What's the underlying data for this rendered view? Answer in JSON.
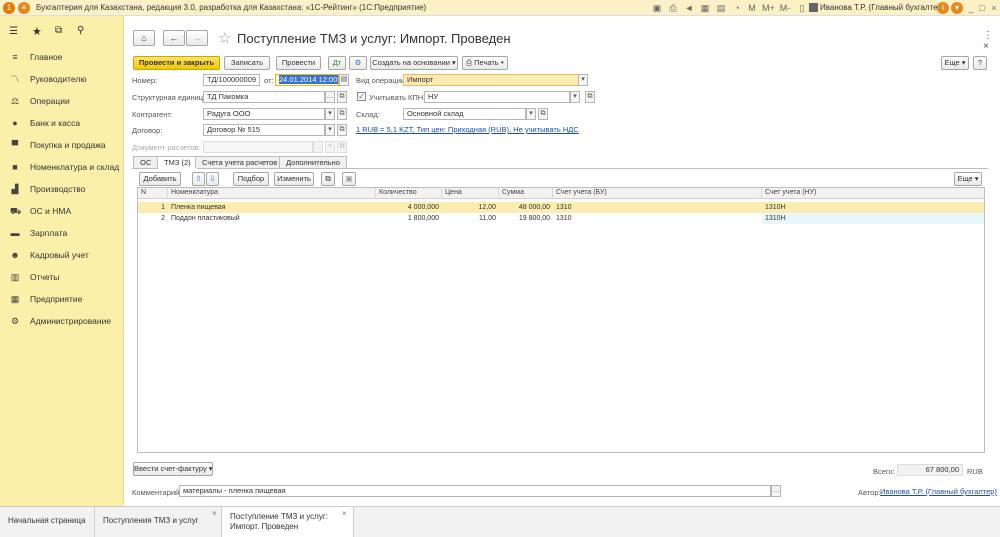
{
  "window": {
    "title": "Бухгалтерия для Казахстана, редакция 3.0, разработка для Казахстана: «1С-Рейтинг» (1С:Предприятие)",
    "user": "Иванова Т.Р. (Главный бухгалтер)",
    "buttons": [
      "M",
      "M+",
      "M-"
    ]
  },
  "sidebar": {
    "items": [
      {
        "label": "Главное",
        "icon": "menu-icon"
      },
      {
        "label": "Руководителю",
        "icon": "chart-line-icon"
      },
      {
        "label": "Операции",
        "icon": "operations-icon"
      },
      {
        "label": "Банк и касса",
        "icon": "coin-icon"
      },
      {
        "label": "Покупка и продажа",
        "icon": "cart-icon"
      },
      {
        "label": "Номенклатура и склад",
        "icon": "box-icon"
      },
      {
        "label": "Производство",
        "icon": "factory-icon"
      },
      {
        "label": "ОС и НМА",
        "icon": "truck-icon"
      },
      {
        "label": "Зарплата",
        "icon": "wallet-icon"
      },
      {
        "label": "Кадровый учет",
        "icon": "people-icon"
      },
      {
        "label": "Отчеты",
        "icon": "report-icon"
      },
      {
        "label": "Предприятие",
        "icon": "building-icon"
      },
      {
        "label": "Администрирование",
        "icon": "gear-icon"
      }
    ]
  },
  "doc": {
    "title": "Поступление ТМЗ и услуг: Импорт. Проведен",
    "more": "Еще",
    "help": "?"
  },
  "toolbar": {
    "post_close": "Провести и закрыть",
    "save": "Записать",
    "post": "Провести",
    "create_based": "Создать на основании",
    "print": "Печать"
  },
  "form": {
    "number_label": "Номер:",
    "number": "ТД/100000009",
    "from_label": "от:",
    "date": "24.01.2014 12:00:0",
    "op_label": "Вид операции:",
    "op": "Импорт",
    "unit_label": "Структурная единица:",
    "unit": "ТД Пакомка",
    "kpn_label": "Учитывать КПН:",
    "kpn": "НУ",
    "contractor_label": "Контрагент:",
    "contractor": "Радуга ООО",
    "warehouse_label": "Склад:",
    "warehouse": "Основной склад",
    "contract_label": "Договор:",
    "contract": "Договор № 515",
    "currency_link": "1 RUB = 5,1 KZT, Тип цен: Приходная (RUB), Не учитывать НДС",
    "settlement_label": "Документ расчетов:"
  },
  "tabs": [
    "ОС",
    "ТМЗ (2)",
    "Счета учета расчетов",
    "Дополнительно"
  ],
  "table_toolbar": {
    "add": "Добавить",
    "select": "Подбор",
    "change": "Изменить",
    "more": "Еще"
  },
  "table": {
    "headers": [
      "N",
      "Номенклатура",
      "Количество",
      "Цена",
      "Сумма",
      "Счет учета (БУ)",
      "Счет учета (НУ)"
    ],
    "rows": [
      {
        "n": "1",
        "name": "Пленка пищевая",
        "qty": "4 000,000",
        "price": "12,00",
        "sum": "48 000,00",
        "bu": "1310",
        "nu": "1310Н"
      },
      {
        "n": "2",
        "name": "Поддон пластиковый",
        "qty": "1 800,000",
        "price": "11,00",
        "sum": "19 800,00",
        "bu": "1310",
        "nu": "1310Н"
      }
    ]
  },
  "footer": {
    "invoice_btn": "Ввести счет-фактуру",
    "total_label": "Всего:",
    "total": "67 800,00",
    "currency": "RUB",
    "comment_label": "Комментарий:",
    "comment": "материалы - пленка пищевая",
    "author_label": "Автор:",
    "author": "Иванова Т.Р. (Главный бухгалтер)"
  },
  "bottom_tabs": [
    "Начальная страница",
    "Поступления ТМЗ и услуг",
    "Поступление ТМЗ и услуг:",
    "Импорт. Проведен"
  ]
}
